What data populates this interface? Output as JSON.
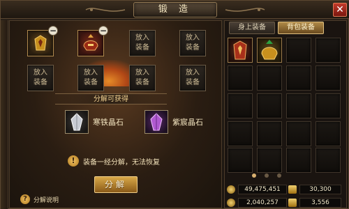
{
  "window": {
    "title": "锻 造"
  },
  "close": {
    "symbol": "✕"
  },
  "left": {
    "empty_slot_label_line1": "放入",
    "empty_slot_label_line2": "装备",
    "slots": [
      {
        "state": "filled",
        "style": "gold",
        "removable": true
      },
      {
        "state": "filled",
        "style": "red",
        "removable": true
      },
      {
        "state": "empty"
      },
      {
        "state": "empty"
      },
      {
        "state": "empty"
      },
      {
        "state": "empty"
      },
      {
        "state": "empty"
      },
      {
        "state": "empty"
      }
    ],
    "result_header": "分解可获得",
    "results": [
      {
        "label": "寒铁晶石",
        "icon": "silver-crystal-icon"
      },
      {
        "label": "紫宸晶石",
        "icon": "purple-crystal-icon"
      }
    ],
    "warning": "装备一经分解，无法恢复",
    "warning_icon": "!",
    "split_button": "分解",
    "help_icon": "?",
    "help_label": "分解说明"
  },
  "right": {
    "tabs": [
      {
        "label": "身上装备",
        "active": false
      },
      {
        "label": "背包装备",
        "active": true
      }
    ],
    "bag_items": [
      {
        "icon": "red-armor-icon"
      },
      {
        "icon": "gold-helmet-icon"
      }
    ],
    "pager_active": 1,
    "currency": [
      {
        "icon": "gold-coin-icon",
        "value": "49,475,451"
      },
      {
        "icon": "gold-ingot-icon",
        "value": "30,300"
      },
      {
        "icon": "gold-coin-icon",
        "value": "2,040,257"
      },
      {
        "icon": "gold-ingot-icon",
        "value": "3,556"
      }
    ]
  },
  "colors": {
    "accent_gold": "#d8a848",
    "close_red": "#c33a2a",
    "panel_bg": "#1a1410"
  }
}
